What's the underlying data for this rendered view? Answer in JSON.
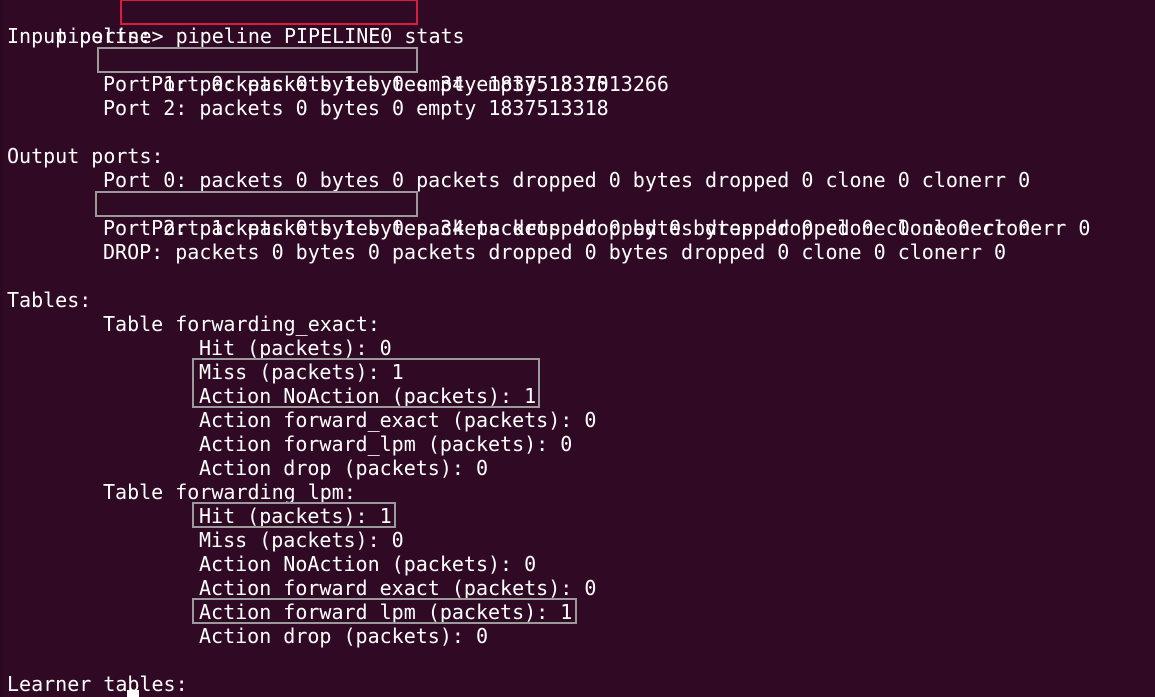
{
  "terminal": {
    "prompt": "pipeline> ",
    "command": "pipeline PIPELINE0 stats",
    "input_ports": {
      "header": "Input ports:",
      "port0_a": "Port 0: packets 1 bytes 34",
      "port0_b": " empty 1837513266",
      "port1": "Port 1: packets 0 bytes 0 empty 1837513310",
      "port2": "Port 2: packets 0 bytes 0 empty 1837513318"
    },
    "output_ports": {
      "header": "Output ports:",
      "port0": "Port 0: packets 0 bytes 0 packets dropped 0 bytes dropped 0 clone 0 clonerr 0",
      "port1_a": "Port 1: packets 1 bytes 34",
      "port1_b": " packets dropped 0 bytes dropped 0 clone 0 clonerr 0",
      "port2": "Port 2: packets 0 bytes 0 packets dropped 0 bytes dropped 0 clone 0 clonerr 0",
      "drop": "DROP: packets 0 bytes 0 packets dropped 0 bytes dropped 0 clone 0 clonerr 0"
    },
    "tables": {
      "header": "Tables:",
      "forwarding_exact": {
        "title": "Table forwarding_exact:",
        "hit": "Hit (packets): 0",
        "miss": "Miss (packets): 1",
        "action_noaction": "Action NoAction (packets): 1",
        "action_forward_exact": "Action forward_exact (packets): 0",
        "action_forward_lpm": "Action forward_lpm (packets): 0",
        "action_drop": "Action drop (packets): 0"
      },
      "forwarding_lpm": {
        "title": "Table forwarding_lpm:",
        "hit": "Hit (packets): 1",
        "miss": "Miss (packets): 0",
        "action_noaction": "Action NoAction (packets): 0",
        "action_forward_exact": "Action forward_exact (packets): 0",
        "action_forward_lpm": "Action forward_lpm (packets): 1",
        "action_drop": "Action drop (packets): 0"
      }
    },
    "learner_tables": {
      "header": "Learner tables:"
    },
    "colors": {
      "background": "#300a24",
      "text": "#ffffff",
      "highlight_command": "#d81e3c",
      "highlight_box": "#9a9a9a"
    }
  }
}
